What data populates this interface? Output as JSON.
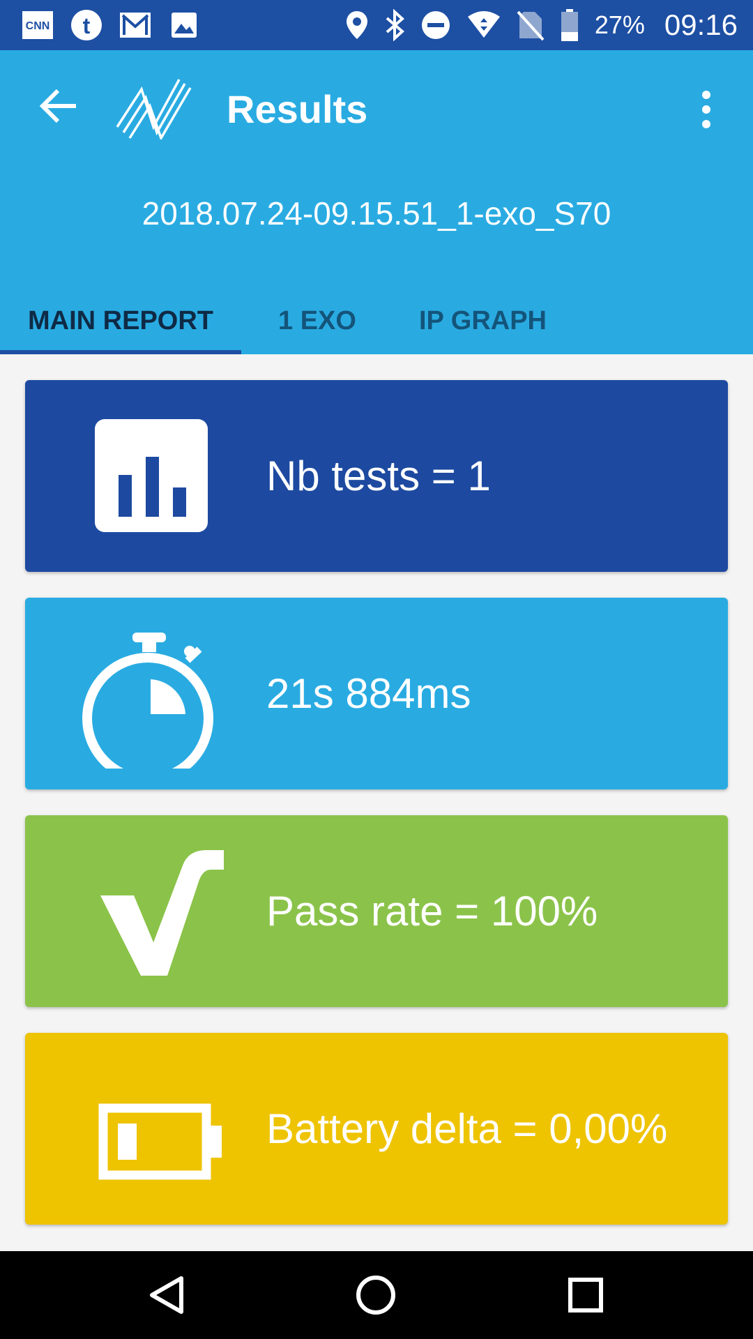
{
  "status_bar": {
    "notification_icons": [
      "cnn-icon",
      "tumblr-icon",
      "gmail-icon",
      "image-icon"
    ],
    "system_icons": [
      "location-icon",
      "bluetooth-icon",
      "do-not-disturb-icon",
      "wifi-icon",
      "no-sim-icon",
      "battery-icon"
    ],
    "battery_percent": "27%",
    "time": "09:16"
  },
  "app_bar": {
    "title": "Results",
    "subtitle": "2018.07.24-09.15.51_1-exo_S70"
  },
  "tabs": [
    {
      "label": "MAIN REPORT",
      "active": true
    },
    {
      "label": "1 EXO",
      "active": false
    },
    {
      "label": "IP GRAPH",
      "active": false
    }
  ],
  "cards": [
    {
      "icon": "bar-chart-icon",
      "text": "Nb tests = 1",
      "color": "#1d4aa0"
    },
    {
      "icon": "stopwatch-icon",
      "text": "21s 884ms",
      "color": "#29abe2"
    },
    {
      "icon": "checkmark-icon",
      "text": "Pass rate = 100%",
      "color": "#8bc34a"
    },
    {
      "icon": "battery-icon",
      "text": "Battery delta = 0,00%",
      "color": "#eec300"
    }
  ],
  "colors": {
    "status_bar": "#1d4fa3",
    "app_bar": "#29abe2",
    "tab_indicator": "#1d4fa3",
    "nav_bar": "#000000"
  }
}
